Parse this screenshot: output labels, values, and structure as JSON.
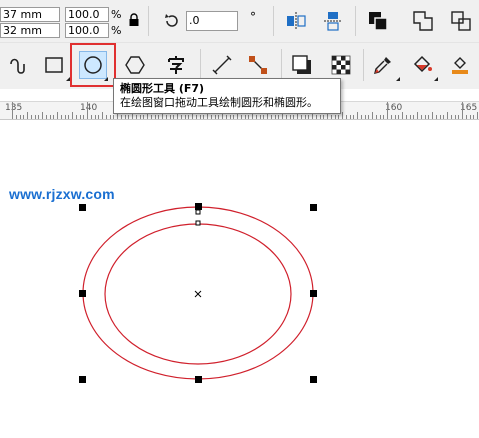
{
  "property_bar": {
    "width_value": "37 mm",
    "height_value": "32 mm",
    "scale_x": "100.0",
    "scale_y": "100.0",
    "percent_unit": "%",
    "rotation_value": ".0",
    "degree_symbol": "°"
  },
  "tooltip": {
    "title": "椭圆形工具 (F7)",
    "description": "在绘图窗口拖动工具绘制圆形和椭圆形。"
  },
  "ruler": {
    "labels": [
      "135",
      "140",
      "160",
      "165"
    ]
  },
  "watermark": "www.rjzxw.com",
  "colors": {
    "ellipse_stroke": "#d0202c",
    "highlight_border": "#e03030",
    "watermark": "#1a6fd1",
    "active_tool_bg": "#cde8ff"
  }
}
